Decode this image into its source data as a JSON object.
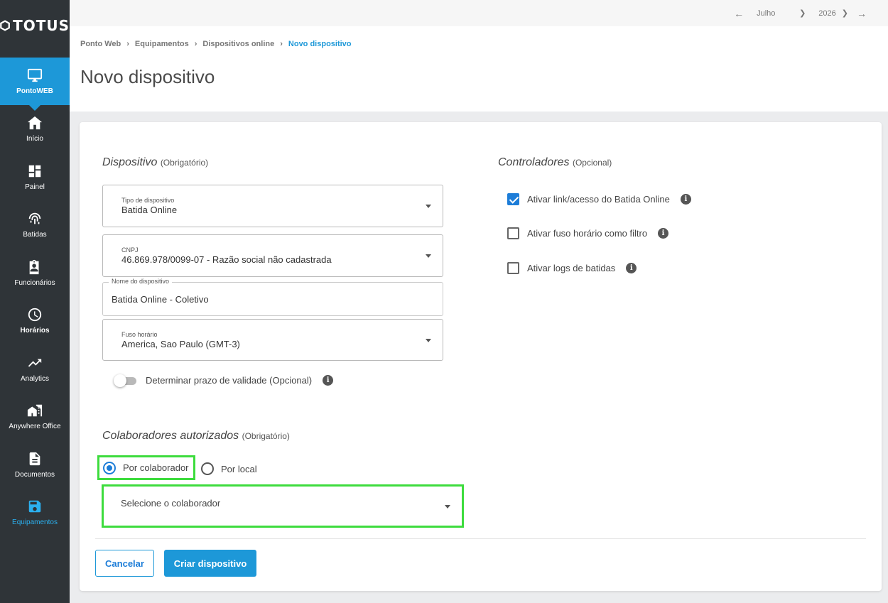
{
  "brand": {
    "name": "TOTUS",
    "accent": "#1d98d8",
    "sidebar_bg": "#2f3438"
  },
  "sidebar": {
    "items": [
      {
        "label": "PontoWEB",
        "icon": "monitor-icon"
      },
      {
        "label": "Início",
        "icon": "home-icon"
      },
      {
        "label": "Painel",
        "icon": "dashboard-icon"
      },
      {
        "label": "Batidas",
        "icon": "fingerprint-icon"
      },
      {
        "label": "Funcionários",
        "icon": "badge-icon"
      },
      {
        "label": "Horários",
        "icon": "clock-icon"
      },
      {
        "label": "Analytics",
        "icon": "trending-icon"
      },
      {
        "label": "Anywhere Office",
        "icon": "home-work-icon"
      },
      {
        "label": "Documentos",
        "icon": "document-icon"
      },
      {
        "label": "Equipamentos",
        "icon": "device-icon"
      }
    ]
  },
  "topbar": {
    "month": "Julho",
    "year": "2026"
  },
  "breadcrumb": {
    "items": [
      "Ponto Web",
      "Equipamentos",
      "Dispositivos online"
    ],
    "current": "Novo dispositivo",
    "separator": "›"
  },
  "page": {
    "title": "Novo dispositivo"
  },
  "device_section": {
    "title": "Dispositivo",
    "qualifier": "(Obrigatório)",
    "device_type": {
      "label": "Tipo de dispositivo",
      "value": "Batida Online"
    },
    "cnpj": {
      "label": "CNPJ",
      "value": "46.869.978/0099-07 - Razão social não cadastrada"
    },
    "device_name": {
      "label": "Nome do dispositivo",
      "value": "Batida Online - Coletivo"
    },
    "timezone": {
      "label": "Fuso horário",
      "value": "America, Sao Paulo (GMT-3)"
    },
    "validity_toggle": {
      "label": "Determinar prazo de validade (Opcional)"
    }
  },
  "controllers_section": {
    "title": "Controladores",
    "qualifier": "(Opcional)",
    "options": [
      {
        "label": "Ativar link/acesso do Batida Online"
      },
      {
        "label": "Ativar fuso horário como filtro"
      },
      {
        "label": "Ativar logs de batidas"
      }
    ]
  },
  "collaborators_section": {
    "title": "Colaboradores autorizados",
    "qualifier": "(Obrigatório)",
    "radio_by_collaborator": "Por colaborador",
    "radio_by_location": "Por local",
    "select_placeholder": "Selecione o colaborador"
  },
  "actions": {
    "cancel": "Cancelar",
    "create": "Criar dispositivo"
  }
}
